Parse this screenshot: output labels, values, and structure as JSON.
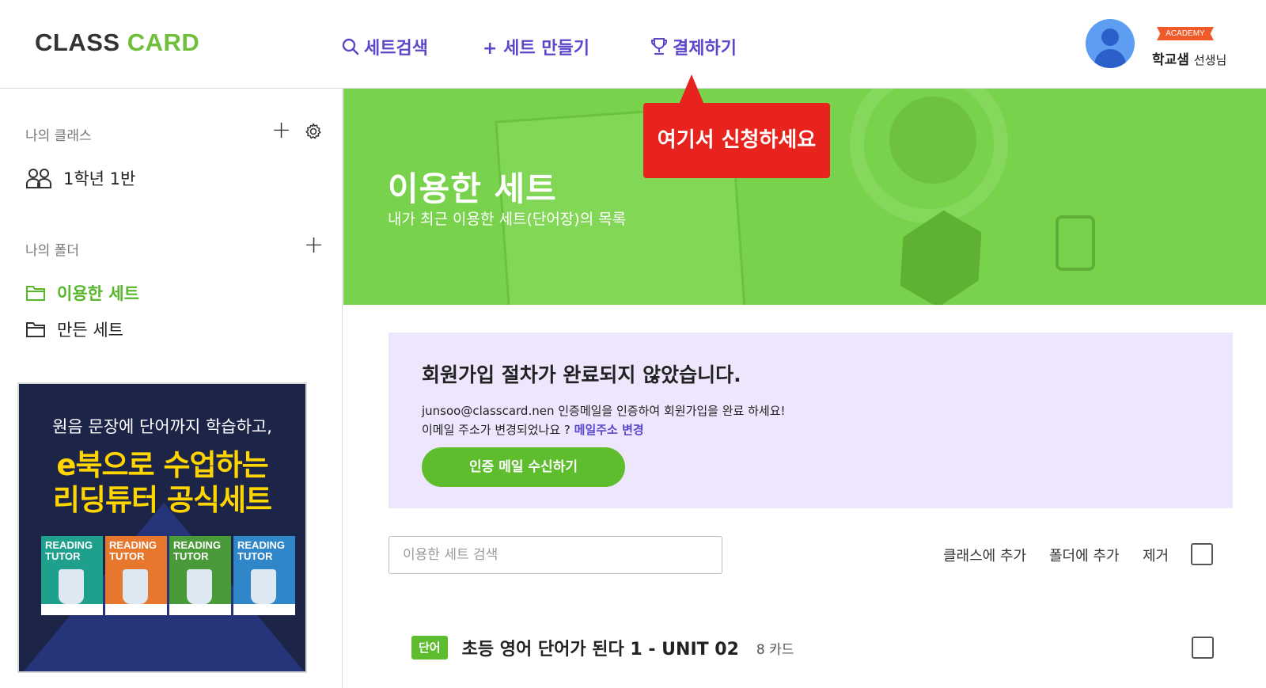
{
  "header": {
    "logo_part1": "CLASS",
    "logo_part2": "CARD",
    "nav": {
      "search": "세트검색",
      "make": "+ 세트 만들기",
      "pay": "결제하기"
    },
    "user": {
      "badge": "ACADEMY",
      "name": "학교샘",
      "honorific": "선생님"
    }
  },
  "sidebar": {
    "class_section_label": "나의 클래스",
    "class_item": "1학년 1반",
    "folder_section_label": "나의 폴더",
    "folders": [
      "이용한 세트",
      "만든 세트"
    ],
    "ad": {
      "line1": "원음 문장에 단어까지 학습하고,",
      "line2": "e북으로 수업하는",
      "line3": "리딩튜터 공식세트",
      "books": [
        {
          "title": "READING TUTOR",
          "color": "#1fa08c"
        },
        {
          "title": "READING TUTOR",
          "color": "#e8772e"
        },
        {
          "title": "READING TUTOR",
          "color": "#4a9a3a"
        },
        {
          "title": "READING TUTOR",
          "color": "#2f86c8"
        }
      ]
    }
  },
  "hero": {
    "title": "이용한 세트",
    "subtitle": "내가 최근 이용한 세트(단어장)의 목록"
  },
  "tooltip": "여기서 신청하세요",
  "notice": {
    "title": "회원가입 절차가 완료되지 않았습니다.",
    "line1": "junsoo@classcard.nen 인증메일을 인증하여 회원가입을 완료 하세요!",
    "line2_prefix": "이메일 주소가 변경되었나요 ? ",
    "line2_link": "메일주소 변경",
    "button": "인증 메일 수신하기"
  },
  "list": {
    "search_placeholder": "이용한 세트 검색",
    "actions": {
      "add_to_class": "클래스에 추가",
      "add_to_folder": "폴더에 추가",
      "remove": "제거"
    },
    "items": [
      {
        "type": "단어",
        "title": "초등 영어 단어가 된다 1 - UNIT 02",
        "count": "8 카드"
      }
    ]
  },
  "colors": {
    "brand_green": "#6fbf3a",
    "nav_purple": "#5b47c9",
    "hero_green": "#78d24b",
    "tooltip_red": "#e8221c",
    "notice_bg": "#ede6fd"
  }
}
